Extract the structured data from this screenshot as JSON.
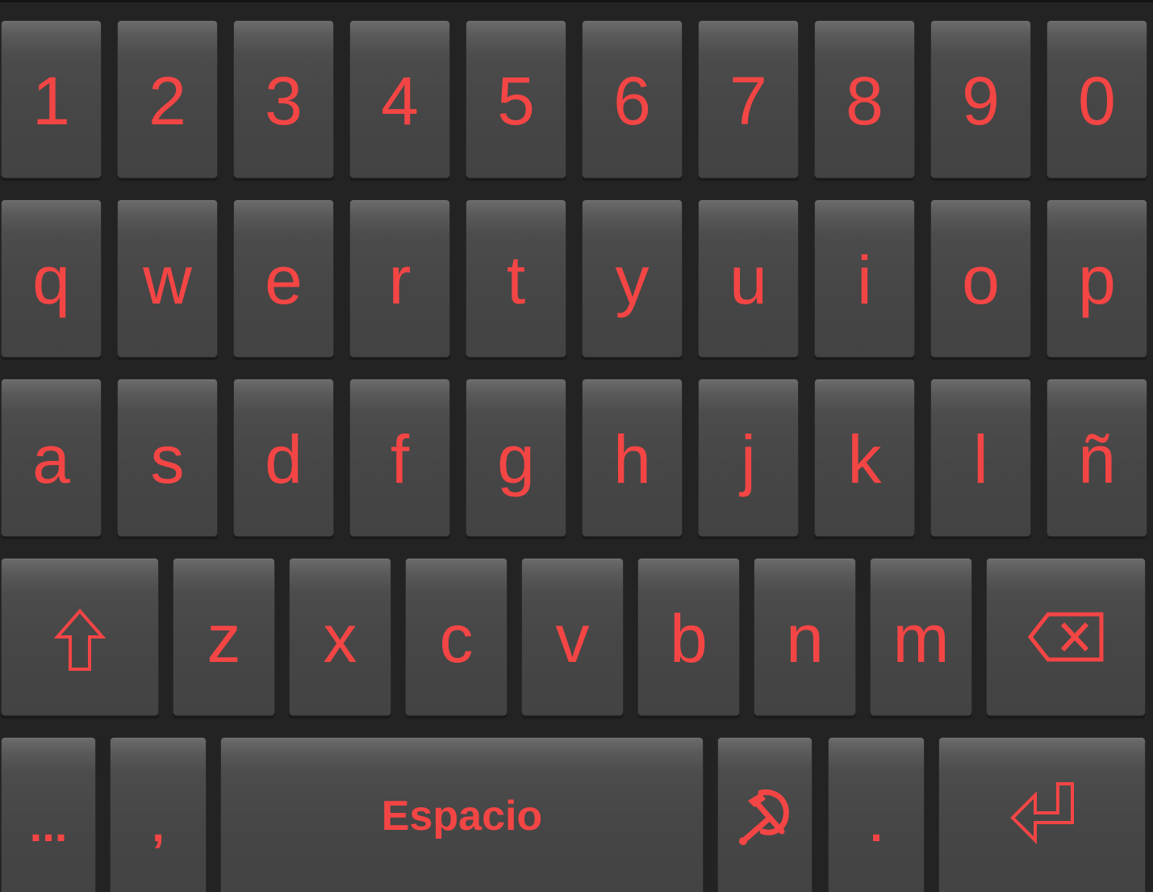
{
  "keyboard": {
    "accent_color": "#f44545",
    "key_color": "#474747",
    "background_color": "#232323",
    "rows": [
      {
        "name": "number-row",
        "keys": [
          {
            "label": "1",
            "name": "key-1"
          },
          {
            "label": "2",
            "name": "key-2"
          },
          {
            "label": "3",
            "name": "key-3"
          },
          {
            "label": "4",
            "name": "key-4"
          },
          {
            "label": "5",
            "name": "key-5"
          },
          {
            "label": "6",
            "name": "key-6"
          },
          {
            "label": "7",
            "name": "key-7"
          },
          {
            "label": "8",
            "name": "key-8"
          },
          {
            "label": "9",
            "name": "key-9"
          },
          {
            "label": "0",
            "name": "key-0"
          }
        ]
      },
      {
        "name": "top-letter-row",
        "keys": [
          {
            "label": "q",
            "name": "key-q"
          },
          {
            "label": "w",
            "name": "key-w"
          },
          {
            "label": "e",
            "name": "key-e"
          },
          {
            "label": "r",
            "name": "key-r"
          },
          {
            "label": "t",
            "name": "key-t"
          },
          {
            "label": "y",
            "name": "key-y"
          },
          {
            "label": "u",
            "name": "key-u"
          },
          {
            "label": "i",
            "name": "key-i"
          },
          {
            "label": "o",
            "name": "key-o"
          },
          {
            "label": "p",
            "name": "key-p"
          }
        ]
      },
      {
        "name": "home-letter-row",
        "keys": [
          {
            "label": "a",
            "name": "key-a"
          },
          {
            "label": "s",
            "name": "key-s"
          },
          {
            "label": "d",
            "name": "key-d"
          },
          {
            "label": "f",
            "name": "key-f"
          },
          {
            "label": "g",
            "name": "key-g"
          },
          {
            "label": "h",
            "name": "key-h"
          },
          {
            "label": "j",
            "name": "key-j"
          },
          {
            "label": "k",
            "name": "key-k"
          },
          {
            "label": "l",
            "name": "key-l"
          },
          {
            "label": "ñ",
            "name": "key-n-tilde"
          }
        ]
      },
      {
        "name": "bottom-letter-row",
        "keys": [
          {
            "icon": "shift-arrow-icon",
            "name": "shift-key"
          },
          {
            "label": "z",
            "name": "key-z"
          },
          {
            "label": "x",
            "name": "key-x"
          },
          {
            "label": "c",
            "name": "key-c"
          },
          {
            "label": "v",
            "name": "key-v"
          },
          {
            "label": "b",
            "name": "key-b"
          },
          {
            "label": "n",
            "name": "key-n"
          },
          {
            "label": "m",
            "name": "key-m"
          },
          {
            "icon": "backspace-icon",
            "name": "backspace-key"
          }
        ]
      },
      {
        "name": "space-row",
        "keys": [
          {
            "label": "...",
            "name": "more-symbols-key"
          },
          {
            "label": ",",
            "name": "comma-key"
          },
          {
            "label": "Espacio",
            "name": "space-key"
          },
          {
            "icon": "hammer-and-sickle-icon",
            "name": "emblem-key"
          },
          {
            "label": ".",
            "name": "period-key"
          },
          {
            "icon": "enter-arrow-icon",
            "name": "enter-key"
          }
        ]
      }
    ]
  }
}
